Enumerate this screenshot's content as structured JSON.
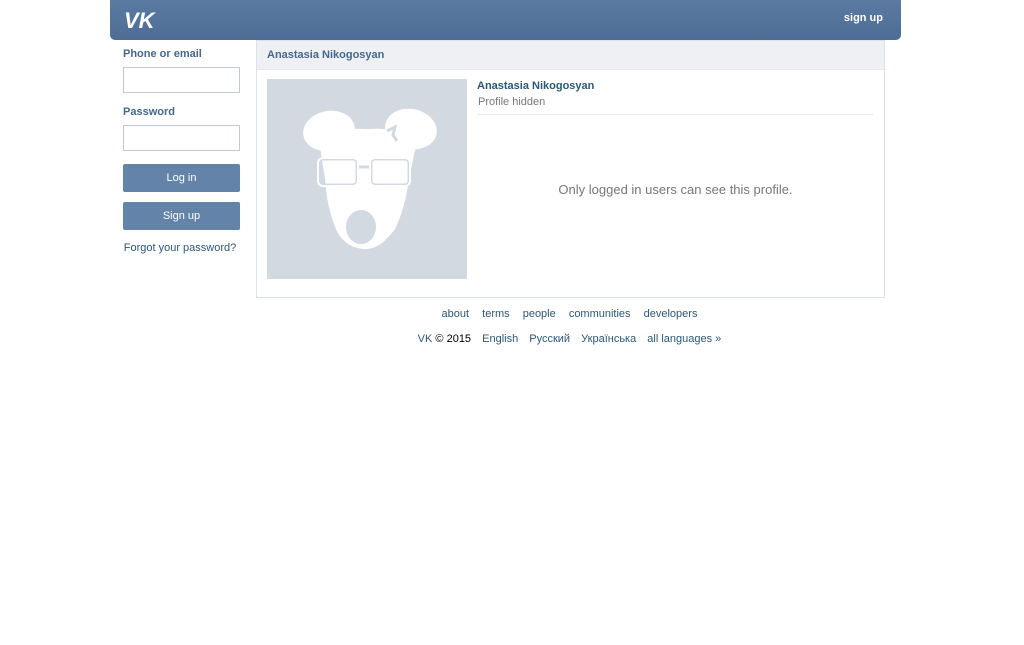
{
  "header": {
    "logo_text": "VK",
    "signup_label": "sign up",
    "bg_color": "#5b7aa2"
  },
  "login": {
    "email_label": "Phone or email",
    "email_value": "",
    "password_label": "Password",
    "password_value": "",
    "login_button": "Log in",
    "signup_button": "Sign up",
    "forgot_link": "Forgot your password?"
  },
  "profile": {
    "panel_title": "Anastasia Nikogosyan",
    "name": "Anastasia Nikogosyan",
    "status": "Profile hidden",
    "message": "Only logged in users can see this profile.",
    "avatar_icon": "vk-dog-placeholder-icon"
  },
  "footer": {
    "links": {
      "about": "about",
      "terms": "terms",
      "people": "people",
      "communities": "communities",
      "developers": "developers"
    },
    "brand": "VK",
    "copyright": "© 2015",
    "languages": {
      "english": "English",
      "russian": "Русский",
      "ukrainian": "Українська",
      "all": "all languages »"
    }
  },
  "colors": {
    "link": "#2b587a",
    "label": "#45688e",
    "button": "#6383a8",
    "avatar_bg": "#d3d9e0"
  }
}
